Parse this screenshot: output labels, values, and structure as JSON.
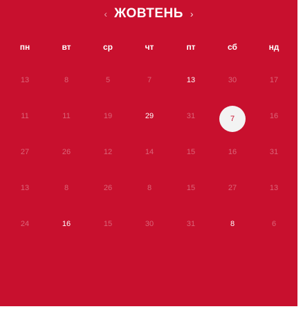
{
  "header": {
    "prev_icon": "‹",
    "month": "ЖОВТЕНЬ",
    "next_icon": "›"
  },
  "weekdays": [
    "пн",
    "вт",
    "ср",
    "чт",
    "пт",
    "сб",
    "нд"
  ],
  "days": [
    [
      "13",
      "8",
      "5",
      "7",
      "13",
      "30",
      "17"
    ],
    [
      "11",
      "11",
      "19",
      "29",
      "31",
      "7",
      "16"
    ],
    [
      "27",
      "26",
      "12",
      "14",
      "15",
      "16",
      "31"
    ],
    [
      "13",
      "8",
      "26",
      "8",
      "15",
      "27",
      "13"
    ],
    [
      "24",
      "16",
      "15",
      "30",
      "31",
      "8",
      "6"
    ]
  ],
  "bright_cells": [
    [
      0,
      4
    ],
    [
      1,
      3
    ],
    [
      4,
      1
    ],
    [
      4,
      5
    ]
  ],
  "selected_cell": [
    1,
    5
  ],
  "colors": {
    "background": "#c8102e",
    "selected_bg": "#f3f3f3"
  }
}
